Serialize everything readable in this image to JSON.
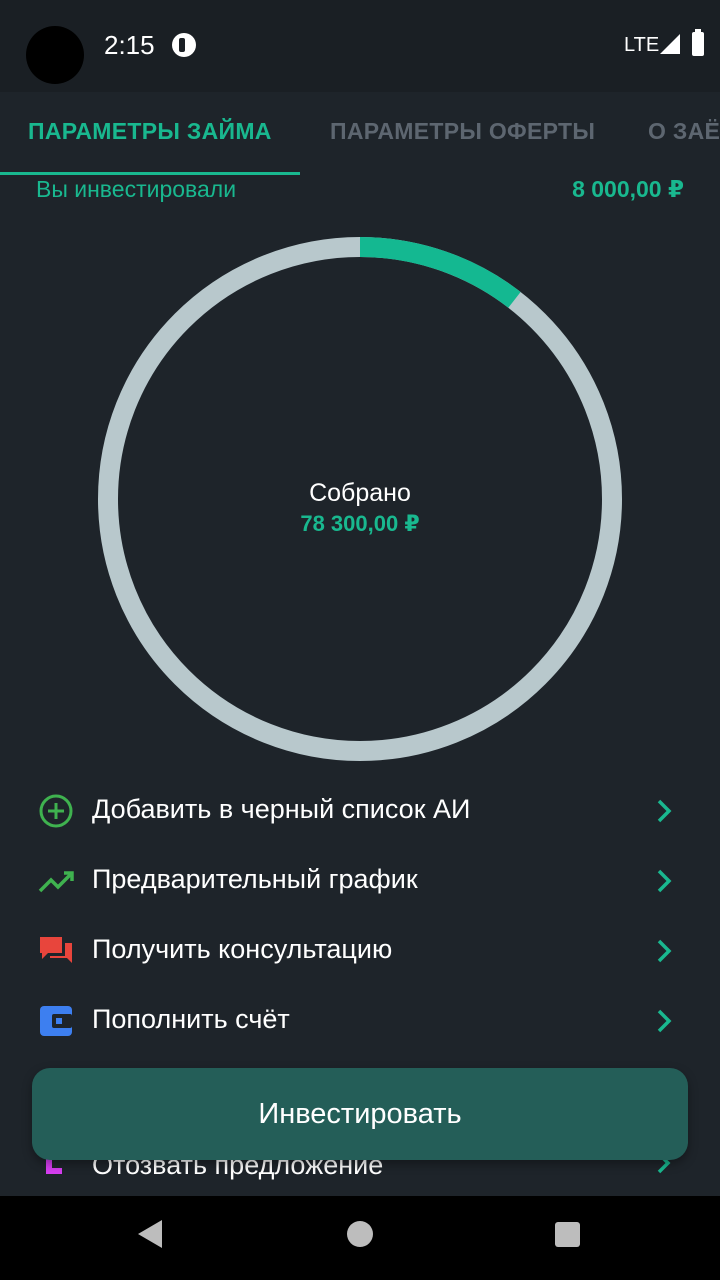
{
  "status_bar": {
    "time": "2:15",
    "network": "LTE"
  },
  "tabs": [
    {
      "label": "ПАРАМЕТРЫ ЗАЙМА",
      "active": true
    },
    {
      "label": "ПАРАМЕТРЫ ОФЕРТЫ",
      "active": false
    },
    {
      "label": "О ЗАЁМЩИКЕ",
      "active": false
    }
  ],
  "invested": {
    "label": "Вы инвестировали",
    "value": "8 000,00 ₽"
  },
  "ring": {
    "label": "Собрано",
    "value": "78 300,00 ₽",
    "progress_fraction": 0.105,
    "colors": {
      "track": "#b8c8cc",
      "fill": "#14b891"
    }
  },
  "menu": [
    {
      "label": "Добавить в черный список АИ",
      "icon": "plus-circle-icon",
      "icon_color": "#3fb24f"
    },
    {
      "label": "Предварительный график",
      "icon": "trend-line-icon",
      "icon_color": "#3fb24f"
    },
    {
      "label": "Получить консультацию",
      "icon": "chat-bubbles-icon",
      "icon_color": "#e8453c"
    },
    {
      "label": "Пополнить счёт",
      "icon": "wallet-icon",
      "icon_color": "#3d7ff0"
    },
    {
      "label": "Отозвать предложение",
      "icon": "withdraw-arrow-icon",
      "icon_color": "#d63ef0"
    }
  ],
  "invest_button": {
    "label": "Инвестировать",
    "color": "#245e58"
  },
  "colors": {
    "accent": "#19b88f",
    "background": "#1e242a",
    "chevron": "#19b88f"
  }
}
